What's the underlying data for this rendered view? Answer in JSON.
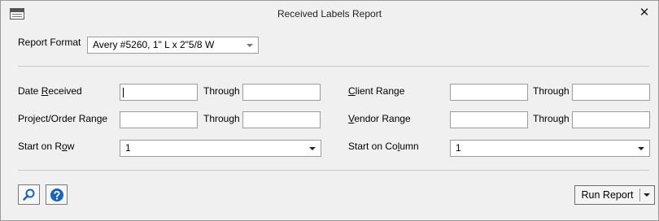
{
  "window": {
    "title": "Received Labels Report",
    "close": "✕"
  },
  "report_format": {
    "label": "Report Format",
    "value": "Avery #5260, 1\" L x 2\"5/8 W"
  },
  "filters": {
    "date_received": {
      "label_pre": "Date ",
      "label_key": "R",
      "label_post": "eceived",
      "from": "",
      "through_label": "Through",
      "through": ""
    },
    "project_order_range": {
      "label": "Project/Order Range",
      "from": "",
      "through_label": "Through",
      "through": ""
    },
    "start_on_row": {
      "label_pre": "Start on R",
      "label_key": "o",
      "label_post": "w",
      "value": "1"
    },
    "client_range": {
      "label_pre": "",
      "label_key": "C",
      "label_post": "lient Range",
      "from": "",
      "through_label": "Through",
      "through": ""
    },
    "vendor_range": {
      "label_pre": "",
      "label_key": "V",
      "label_post": "endor Range",
      "from": "",
      "through_label": "Through",
      "through": ""
    },
    "start_on_column": {
      "label_pre": "Start on Co",
      "label_key": "l",
      "label_post": "umn",
      "value": "1"
    }
  },
  "footer": {
    "run_report_label": "Run Report",
    "icons": [
      "search-icon",
      "help-icon"
    ]
  },
  "colors": {
    "icon_blue": "#1565c0"
  }
}
